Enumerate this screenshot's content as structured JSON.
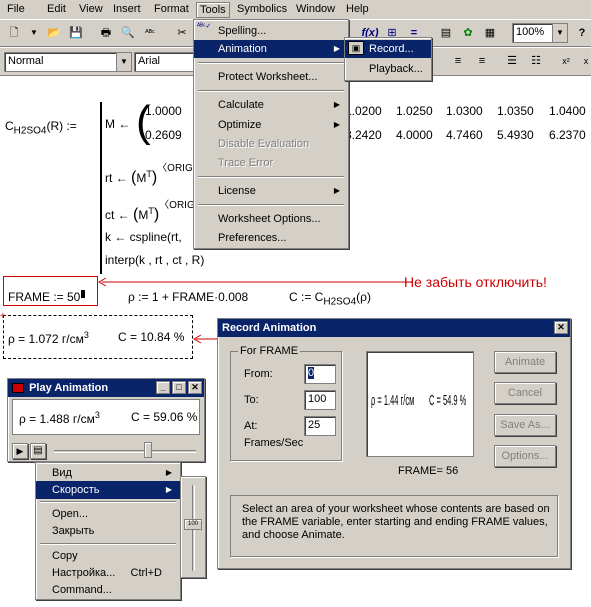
{
  "menubar": {
    "items": [
      "File",
      "Edit",
      "View",
      "Insert",
      "Format",
      "Tools",
      "Symbolics",
      "Window",
      "Help"
    ]
  },
  "toolbar": {
    "zoom": "100%",
    "style": "Normal",
    "font": "Arial"
  },
  "tools_menu": {
    "items": [
      {
        "label": "Spelling..."
      },
      {
        "label": "Animation"
      },
      {
        "label": "Protect Worksheet..."
      },
      {
        "label": "Calculate"
      },
      {
        "label": "Optimize"
      },
      {
        "label": "Disable Evaluation"
      },
      {
        "label": "Trace Error"
      },
      {
        "label": "License"
      },
      {
        "label": "Worksheet Options..."
      },
      {
        "label": "Preferences..."
      }
    ]
  },
  "animation_submenu": {
    "record": "Record...",
    "playback": "Playback..."
  },
  "worksheet": {
    "func_def": "C",
    "func_sub": "H2SO4",
    "func_arg": "(R) :=",
    "m_label": "M ←",
    "m_row1": [
      "1.0000",
      "1.0200",
      "1.0250",
      "1.0300",
      "1.0350",
      "1.0400"
    ],
    "m_row2": [
      "0.2609",
      "3.2420",
      "4.0000",
      "4.7460",
      "5.4930",
      "6.2370"
    ],
    "rt_line": "rt ←",
    "ct_line": "ct ←",
    "transpose_m": "M",
    "sup_t": "T",
    "sup_orig": "〈ORIG",
    "k_line": "k ← cspline(rt,",
    "interp_line": "interp(k , rt , ct , R)",
    "frame_def": "FRAME := 50",
    "rho_def": "ρ := 1 + FRAME·0.008",
    "c_def": "C := C",
    "c_def_sub": "H2SO4",
    "c_def_arg": "(ρ)",
    "reminder": "Не забыть отключить!",
    "result_rho": "ρ = 1.072 г/см",
    "result_rho_sup": "3",
    "result_c": "C = 10.84 %"
  },
  "play_animation": {
    "title": "Play Animation",
    "rho": "ρ = 1.488 г/см",
    "rho_sup": "3",
    "c": "C = 59.06 %"
  },
  "context_menu": {
    "items": [
      {
        "label": "Вид"
      },
      {
        "label": "Скорость"
      },
      {
        "label": "Open..."
      },
      {
        "label": "Закрыть"
      },
      {
        "label": "Copy"
      },
      {
        "label": "Настройка...",
        "shortcut": "Ctrl+D"
      },
      {
        "label": "Command..."
      }
    ],
    "speed_value": "100"
  },
  "record_dialog": {
    "title": "Record Animation",
    "group": "For FRAME",
    "from_label": "From:",
    "from_value": "0",
    "to_label": "To:",
    "to_value": "100",
    "at_label": "At:",
    "at_value": "25",
    "fps_label": "Frames/Sec",
    "preview_rho": "ρ = 1.44 г/см",
    "preview_c": "C = 54.9 %",
    "frame_readout": "FRAME= 56",
    "buttons": [
      "Animate",
      "Cancel",
      "Save As...",
      "Options..."
    ],
    "hint": "Select an area of your worksheet whose contents are based on the FRAME variable, enter starting and ending FRAME values, and choose Animate."
  }
}
